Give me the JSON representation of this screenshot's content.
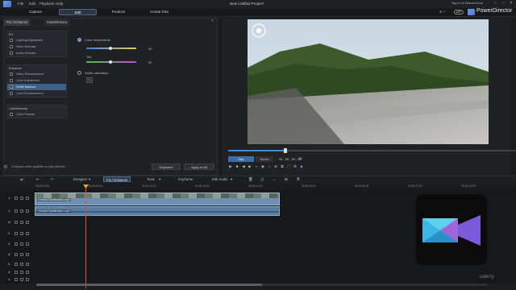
{
  "window": {
    "menu": [
      "File",
      "Edit",
      "Playback",
      "Help"
    ],
    "title": "New Untitled Project*",
    "signin": "Sign in to DirectorZone",
    "brand": "PowerDirector",
    "app_badge": "APP"
  },
  "modes": [
    "Capture",
    "Edit",
    "Produce",
    "Create Disc"
  ],
  "active_mode": "Edit",
  "panel": {
    "tabs": [
      "Fix / Enhance",
      "ColorDirector"
    ],
    "fix": {
      "header": "Fix",
      "items": [
        "Lighting Adjustment",
        "Video Denoise",
        "Audio Denoise"
      ]
    },
    "enhance": {
      "header": "Enhance",
      "items": [
        "Video Enhancement",
        "Color Adjustment",
        "White Balance",
        "Color Enhancement"
      ],
      "selected": "White Balance"
    },
    "colordirector": {
      "header": "ColorDirector",
      "items": [
        "Color Presets"
      ]
    },
    "options": {
      "color_temperature": {
        "label": "Color temperature",
        "value": "50"
      },
      "tint": {
        "label": "Tint",
        "value": "50"
      },
      "white_calibration": {
        "label": "White calibration"
      }
    },
    "compare_label": "Compare video qualities in split preview",
    "keyframe_label": "Keyframe",
    "apply_all_label": "Apply to All"
  },
  "player": {
    "clip_label": "Clip",
    "movie_label": "Movie",
    "timecode": "00 ; 00 ; 02 ; 02",
    "quality_badge": "3D"
  },
  "toolbar": {
    "designer_label": "Designer",
    "fix_enhance_label": "Fix / Enhance",
    "tools_label": "Tools",
    "keyframe_label": "Keyframe",
    "edit_audio_label": "Edit Audio"
  },
  "timeline": {
    "ticks": [
      "00;00;00;00",
      "00;00;05;10",
      "00;00;10;20",
      "00;00;16;00",
      "00;00;21;10",
      "00;00;26;20",
      "00;00;32;00",
      "00;00;37;10",
      "00;00;42;20"
    ],
    "tracks": [
      "1.",
      "1.",
      "fx",
      "2.",
      "2.",
      "3.",
      "3.",
      "4.",
      "4."
    ],
    "video_clip_label": "Gimbal.Stabilization.mp4",
    "audio_clip_label": "Gimbal.Stabilization.mp4"
  },
  "watermark": "udemy"
}
